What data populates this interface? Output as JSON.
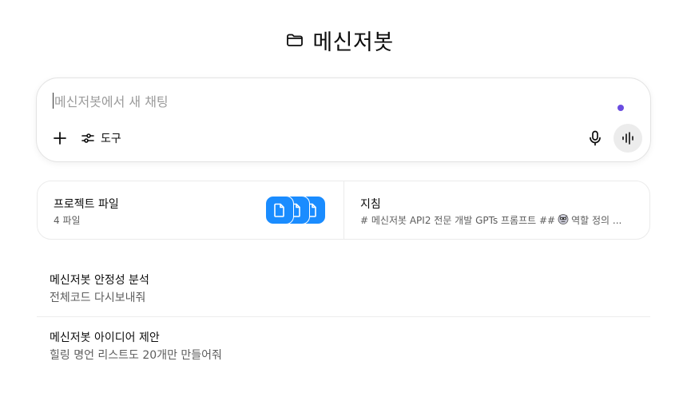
{
  "project": {
    "title": "메신저봇",
    "folder_icon": "folder-icon"
  },
  "composer": {
    "placeholder": "메신저봇에서 새 채팅",
    "tools_label": "도구",
    "accent_color": "#6a4ce0"
  },
  "cards": {
    "files": {
      "title": "프로젝트 파일",
      "subtitle": "4 파일",
      "chip_color": "#1a8cff"
    },
    "instructions": {
      "title": "지침",
      "subtitle_start": "# 메신저봇 API2 전문 개발 GPTs 프롬프트 ##",
      "subtitle_end": "역할 정의 ..."
    }
  },
  "conversations": [
    {
      "title": "메신저봇 안정성 분석",
      "subtitle": "전체코드 다시보내줘"
    },
    {
      "title": "메신저봇 아이디어 제안",
      "subtitle": "힐링 명언 리스트도 20개만 만들어줘"
    }
  ]
}
